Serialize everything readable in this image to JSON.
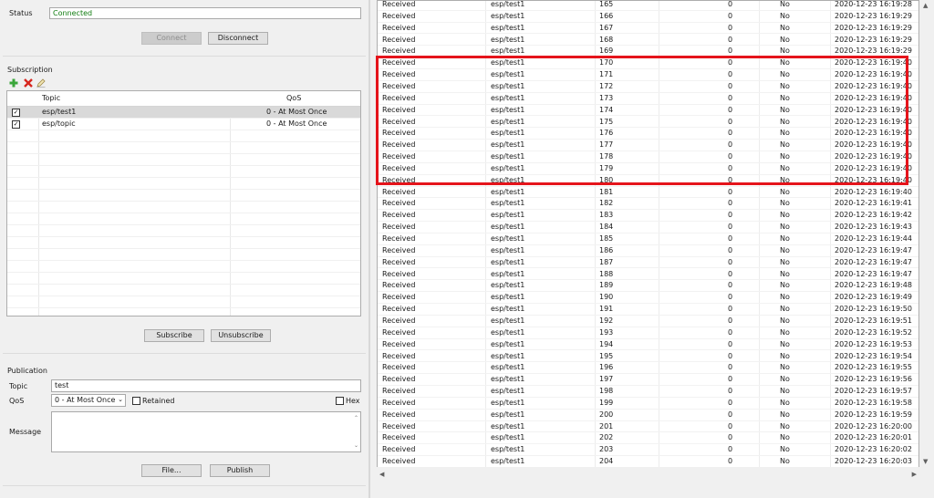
{
  "connection": {
    "status_label": "Status",
    "status_value": "Connected",
    "connect_label": "Connect",
    "disconnect_label": "Disconnect"
  },
  "subscription": {
    "title": "Subscription",
    "col_topic": "Topic",
    "col_qos": "QoS",
    "rows": [
      {
        "topic": "esp/test1",
        "qos": "0 - At Most Once",
        "checked": true
      },
      {
        "topic": "esp/topic",
        "qos": "0 - At Most Once",
        "checked": true
      }
    ],
    "subscribe_label": "Subscribe",
    "unsubscribe_label": "Unsubscribe"
  },
  "publication": {
    "title": "Publication",
    "topic_label": "Topic",
    "topic_value": "test",
    "qos_label": "QoS",
    "qos_value": "0 - At Most Once",
    "retained_label": "Retained",
    "hex_label": "Hex",
    "message_label": "Message",
    "file_label": "File...",
    "publish_label": "Publish"
  },
  "messages": [
    {
      "dir": "Received",
      "topic": "esp/test1",
      "id": "165",
      "qos": "0",
      "retained": "No",
      "time": "2020-12-23 16:19:28"
    },
    {
      "dir": "Received",
      "topic": "esp/test1",
      "id": "166",
      "qos": "0",
      "retained": "No",
      "time": "2020-12-23 16:19:29"
    },
    {
      "dir": "Received",
      "topic": "esp/test1",
      "id": "167",
      "qos": "0",
      "retained": "No",
      "time": "2020-12-23 16:19:29"
    },
    {
      "dir": "Received",
      "topic": "esp/test1",
      "id": "168",
      "qos": "0",
      "retained": "No",
      "time": "2020-12-23 16:19:29"
    },
    {
      "dir": "Received",
      "topic": "esp/test1",
      "id": "169",
      "qos": "0",
      "retained": "No",
      "time": "2020-12-23 16:19:29"
    },
    {
      "dir": "Received",
      "topic": "esp/test1",
      "id": "170",
      "qos": "0",
      "retained": "No",
      "time": "2020-12-23 16:19:40"
    },
    {
      "dir": "Received",
      "topic": "esp/test1",
      "id": "171",
      "qos": "0",
      "retained": "No",
      "time": "2020-12-23 16:19:40"
    },
    {
      "dir": "Received",
      "topic": "esp/test1",
      "id": "172",
      "qos": "0",
      "retained": "No",
      "time": "2020-12-23 16:19:40"
    },
    {
      "dir": "Received",
      "topic": "esp/test1",
      "id": "173",
      "qos": "0",
      "retained": "No",
      "time": "2020-12-23 16:19:40"
    },
    {
      "dir": "Received",
      "topic": "esp/test1",
      "id": "174",
      "qos": "0",
      "retained": "No",
      "time": "2020-12-23 16:19:40"
    },
    {
      "dir": "Received",
      "topic": "esp/test1",
      "id": "175",
      "qos": "0",
      "retained": "No",
      "time": "2020-12-23 16:19:40"
    },
    {
      "dir": "Received",
      "topic": "esp/test1",
      "id": "176",
      "qos": "0",
      "retained": "No",
      "time": "2020-12-23 16:19:40"
    },
    {
      "dir": "Received",
      "topic": "esp/test1",
      "id": "177",
      "qos": "0",
      "retained": "No",
      "time": "2020-12-23 16:19:40"
    },
    {
      "dir": "Received",
      "topic": "esp/test1",
      "id": "178",
      "qos": "0",
      "retained": "No",
      "time": "2020-12-23 16:19:40"
    },
    {
      "dir": "Received",
      "topic": "esp/test1",
      "id": "179",
      "qos": "0",
      "retained": "No",
      "time": "2020-12-23 16:19:40"
    },
    {
      "dir": "Received",
      "topic": "esp/test1",
      "id": "180",
      "qos": "0",
      "retained": "No",
      "time": "2020-12-23 16:19:40"
    },
    {
      "dir": "Received",
      "topic": "esp/test1",
      "id": "181",
      "qos": "0",
      "retained": "No",
      "time": "2020-12-23 16:19:40"
    },
    {
      "dir": "Received",
      "topic": "esp/test1",
      "id": "182",
      "qos": "0",
      "retained": "No",
      "time": "2020-12-23 16:19:41"
    },
    {
      "dir": "Received",
      "topic": "esp/test1",
      "id": "183",
      "qos": "0",
      "retained": "No",
      "time": "2020-12-23 16:19:42"
    },
    {
      "dir": "Received",
      "topic": "esp/test1",
      "id": "184",
      "qos": "0",
      "retained": "No",
      "time": "2020-12-23 16:19:43"
    },
    {
      "dir": "Received",
      "topic": "esp/test1",
      "id": "185",
      "qos": "0",
      "retained": "No",
      "time": "2020-12-23 16:19:44"
    },
    {
      "dir": "Received",
      "topic": "esp/test1",
      "id": "186",
      "qos": "0",
      "retained": "No",
      "time": "2020-12-23 16:19:47"
    },
    {
      "dir": "Received",
      "topic": "esp/test1",
      "id": "187",
      "qos": "0",
      "retained": "No",
      "time": "2020-12-23 16:19:47"
    },
    {
      "dir": "Received",
      "topic": "esp/test1",
      "id": "188",
      "qos": "0",
      "retained": "No",
      "time": "2020-12-23 16:19:47"
    },
    {
      "dir": "Received",
      "topic": "esp/test1",
      "id": "189",
      "qos": "0",
      "retained": "No",
      "time": "2020-12-23 16:19:48"
    },
    {
      "dir": "Received",
      "topic": "esp/test1",
      "id": "190",
      "qos": "0",
      "retained": "No",
      "time": "2020-12-23 16:19:49"
    },
    {
      "dir": "Received",
      "topic": "esp/test1",
      "id": "191",
      "qos": "0",
      "retained": "No",
      "time": "2020-12-23 16:19:50"
    },
    {
      "dir": "Received",
      "topic": "esp/test1",
      "id": "192",
      "qos": "0",
      "retained": "No",
      "time": "2020-12-23 16:19:51"
    },
    {
      "dir": "Received",
      "topic": "esp/test1",
      "id": "193",
      "qos": "0",
      "retained": "No",
      "time": "2020-12-23 16:19:52"
    },
    {
      "dir": "Received",
      "topic": "esp/test1",
      "id": "194",
      "qos": "0",
      "retained": "No",
      "time": "2020-12-23 16:19:53"
    },
    {
      "dir": "Received",
      "topic": "esp/test1",
      "id": "195",
      "qos": "0",
      "retained": "No",
      "time": "2020-12-23 16:19:54"
    },
    {
      "dir": "Received",
      "topic": "esp/test1",
      "id": "196",
      "qos": "0",
      "retained": "No",
      "time": "2020-12-23 16:19:55"
    },
    {
      "dir": "Received",
      "topic": "esp/test1",
      "id": "197",
      "qos": "0",
      "retained": "No",
      "time": "2020-12-23 16:19:56"
    },
    {
      "dir": "Received",
      "topic": "esp/test1",
      "id": "198",
      "qos": "0",
      "retained": "No",
      "time": "2020-12-23 16:19:57"
    },
    {
      "dir": "Received",
      "topic": "esp/test1",
      "id": "199",
      "qos": "0",
      "retained": "No",
      "time": "2020-12-23 16:19:58"
    },
    {
      "dir": "Received",
      "topic": "esp/test1",
      "id": "200",
      "qos": "0",
      "retained": "No",
      "time": "2020-12-23 16:19:59"
    },
    {
      "dir": "Received",
      "topic": "esp/test1",
      "id": "201",
      "qos": "0",
      "retained": "No",
      "time": "2020-12-23 16:20:00"
    },
    {
      "dir": "Received",
      "topic": "esp/test1",
      "id": "202",
      "qos": "0",
      "retained": "No",
      "time": "2020-12-23 16:20:01"
    },
    {
      "dir": "Received",
      "topic": "esp/test1",
      "id": "203",
      "qos": "0",
      "retained": "No",
      "time": "2020-12-23 16:20:02"
    },
    {
      "dir": "Received",
      "topic": "esp/test1",
      "id": "204",
      "qos": "0",
      "retained": "No",
      "time": "2020-12-23 16:20:03"
    }
  ],
  "colors": {
    "status_green": "#107c10",
    "highlight_red": "#e5141b",
    "add_icon_green": "#3aa63a",
    "delete_icon_red": "#d7261e"
  }
}
